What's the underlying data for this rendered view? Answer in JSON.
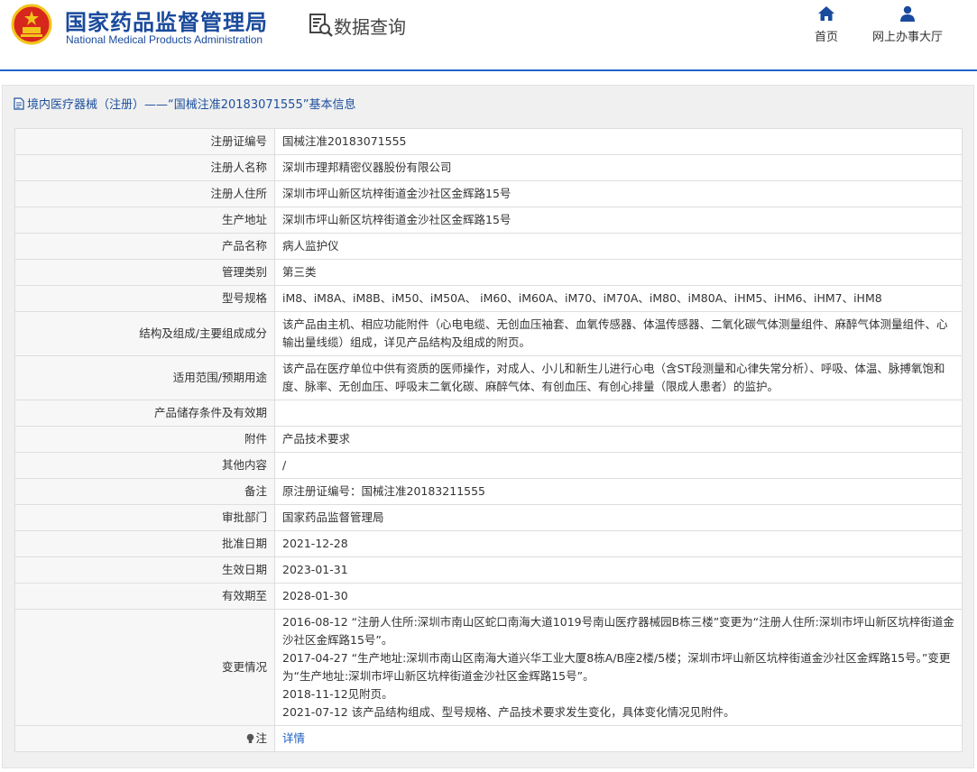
{
  "header": {
    "brand_cn": "国家药品监督管理局",
    "brand_en": "National Medical Products Administration",
    "section_title": "数据查询",
    "nav": [
      {
        "label": "首页",
        "icon": "home-icon"
      },
      {
        "label": "网上办事大厅",
        "icon": "user-icon"
      }
    ],
    "colors": {
      "brand": "#1a4a9c",
      "header_line": "#1f64c8",
      "emblem_red": "#d7261c",
      "emblem_gold": "#f2c41c"
    }
  },
  "panel": {
    "title": "境内医疗器械（注册）——“国械注准20183071555”基本信息"
  },
  "rows": [
    {
      "label": "注册证编号",
      "value": "国械注准20183071555"
    },
    {
      "label": "注册人名称",
      "value": "深圳市理邦精密仪器股份有限公司"
    },
    {
      "label": "注册人住所",
      "value": "深圳市坪山新区坑梓街道金沙社区金辉路15号"
    },
    {
      "label": "生产地址",
      "value": "深圳市坪山新区坑梓街道金沙社区金辉路15号"
    },
    {
      "label": "产品名称",
      "value": "病人监护仪"
    },
    {
      "label": "管理类别",
      "value": "第三类"
    },
    {
      "label": "型号规格",
      "value": "iM8、iM8A、iM8B、iM50、iM50A、 iM60、iM60A、iM70、iM70A、iM80、iM80A、iHM5、iHM6、iHM7、iHM8"
    },
    {
      "label": "结构及组成/主要组成成分",
      "value": "该产品由主机、相应功能附件（心电电缆、无创血压袖套、血氧传感器、体温传感器、二氧化碳气体测量组件、麻醉气体测量组件、心输出量线缆）组成，详见产品结构及组成的附页。"
    },
    {
      "label": "适用范围/预期用途",
      "value": "该产品在医疗单位中供有资质的医师操作，对成人、小儿和新生儿进行心电（含ST段测量和心律失常分析）、呼吸、体温、脉搏氧饱和度、脉率、无创血压、呼吸末二氧化碳、麻醉气体、有创血压、有创心排量（限成人患者）的监护。"
    },
    {
      "label": "产品储存条件及有效期",
      "value": ""
    },
    {
      "label": "附件",
      "value": "产品技术要求"
    },
    {
      "label": "其他内容",
      "value": "/"
    },
    {
      "label": "备注",
      "value": "原注册证编号：国械注准20183211555"
    },
    {
      "label": "审批部门",
      "value": "国家药品监督管理局"
    },
    {
      "label": "批准日期",
      "value": "2021-12-28"
    },
    {
      "label": "生效日期",
      "value": "2023-01-31"
    },
    {
      "label": "有效期至",
      "value": "2028-01-30"
    }
  ],
  "changes": {
    "label": "变更情况",
    "lines": [
      "2016-08-12 “注册人住所:深圳市南山区蛇口南海大道1019号南山医疗器械园B栋三楼”变更为“注册人住所:深圳市坪山新区坑梓街道金沙社区金辉路15号”。",
      "2017-04-27 “生产地址:深圳市南山区南海大道兴华工业大厦8栋A/B座2楼/5楼；深圳市坪山新区坑梓街道金沙社区金辉路15号。”变更为“生产地址:深圳市坪山新区坑梓街道金沙社区金辉路15号”。",
      "2018-11-12见附页。",
      "2021-07-12 该产品结构组成、型号规格、产品技术要求发生变化，具体变化情况见附件。"
    ]
  },
  "note": {
    "icon": "lightbulb-icon",
    "label": "注",
    "link": "详情"
  }
}
